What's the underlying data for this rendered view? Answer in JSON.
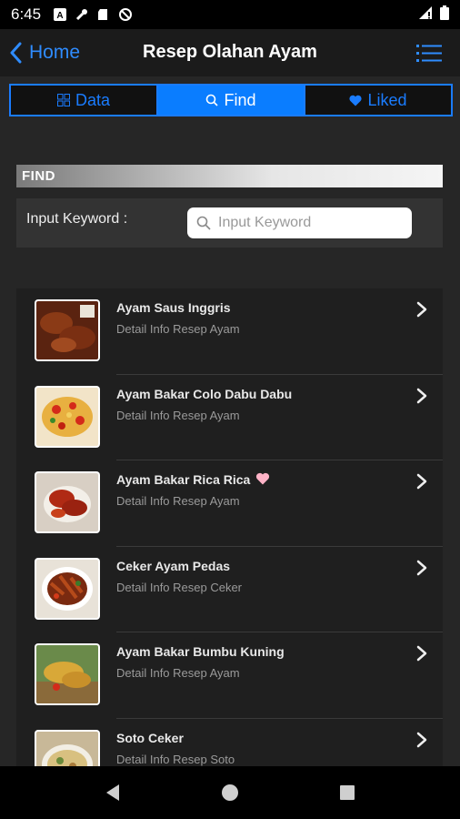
{
  "status_bar": {
    "time": "6:45"
  },
  "nav": {
    "back_label": "Home",
    "title": "Resep Olahan Ayam"
  },
  "tabs": [
    {
      "label": "Data",
      "icon": "grid-icon"
    },
    {
      "label": "Find",
      "icon": "search-icon"
    },
    {
      "label": "Liked",
      "icon": "heart-icon"
    }
  ],
  "find": {
    "header": "FIND",
    "label": "Input Keyword :",
    "placeholder": "Input Keyword"
  },
  "items": [
    {
      "title": "Ayam Saus Inggris",
      "subtitle": "Detail Info Resep Ayam",
      "liked": false
    },
    {
      "title": "Ayam Bakar Colo Dabu Dabu",
      "subtitle": "Detail Info Resep Ayam",
      "liked": false
    },
    {
      "title": "Ayam Bakar Rica Rica",
      "subtitle": "Detail Info Resep Ayam",
      "liked": true
    },
    {
      "title": "Ceker Ayam Pedas",
      "subtitle": "Detail Info Resep Ceker",
      "liked": false
    },
    {
      "title": "Ayam Bakar Bumbu Kuning",
      "subtitle": "Detail Info Resep Ayam",
      "liked": false
    },
    {
      "title": "Soto Ceker",
      "subtitle": "Detail Info Resep Soto",
      "liked": false
    }
  ],
  "colors": {
    "accent": "#0a7dff",
    "liked": "#ffb3c7"
  }
}
